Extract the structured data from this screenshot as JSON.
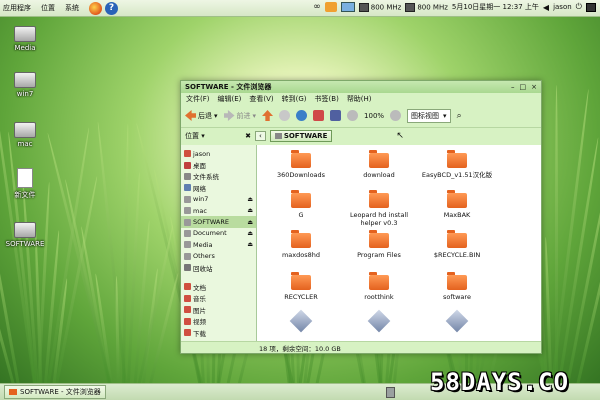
{
  "top_panel": {
    "menus": [
      "应用程序",
      "位置",
      "系统"
    ],
    "cpu1": "800 MHz",
    "cpu2": "800 MHz",
    "datetime": "5月10日星期一 12:37 上午",
    "user": "jason"
  },
  "desktop_icons": [
    "Media",
    "win7",
    "mac",
    "新文件",
    "SOFTWARE"
  ],
  "window": {
    "title": "SOFTWARE - 文件浏览器",
    "menubar": [
      "文件(F)",
      "编辑(E)",
      "查看(V)",
      "转到(G)",
      "书签(B)",
      "帮助(H)"
    ],
    "toolbar": {
      "back": "后退",
      "forward": "前进",
      "zoom": "100%",
      "view": "图标视图"
    },
    "sidebar_title": "位置",
    "path": "SOFTWARE",
    "sidebar_items": [
      {
        "label": "jason",
        "color": "#d05040"
      },
      {
        "label": "桌面",
        "color": "#c04040"
      },
      {
        "label": "文件系统",
        "color": "#888888"
      },
      {
        "label": "网络",
        "color": "#6080b0"
      },
      {
        "label": "win7",
        "color": "#999999",
        "eject": true
      },
      {
        "label": "mac",
        "color": "#999999",
        "eject": true
      },
      {
        "label": "SOFTWARE",
        "color": "#999999",
        "eject": true,
        "selected": true
      },
      {
        "label": "Document",
        "color": "#999999",
        "eject": true
      },
      {
        "label": "Media",
        "color": "#999999",
        "eject": true
      },
      {
        "label": "Others",
        "color": "#999999"
      },
      {
        "label": "回收站",
        "color": "#777777"
      },
      {
        "label": "文档",
        "color": "#d05040"
      },
      {
        "label": "音乐",
        "color": "#d05040"
      },
      {
        "label": "图片",
        "color": "#d05040"
      },
      {
        "label": "视频",
        "color": "#d05040"
      },
      {
        "label": "下载",
        "color": "#d05040"
      }
    ],
    "files": [
      {
        "name": "360Downloads",
        "type": "folder"
      },
      {
        "name": "download",
        "type": "folder"
      },
      {
        "name": "EasyBCD_v1.51汉化版",
        "type": "folder"
      },
      {
        "name": "G",
        "type": "folder"
      },
      {
        "name": "Leopard hd install helper v0.3",
        "type": "folder"
      },
      {
        "name": "MaxBAK",
        "type": "folder"
      },
      {
        "name": "maxdos8hd",
        "type": "folder"
      },
      {
        "name": "Program Files",
        "type": "folder"
      },
      {
        "name": "$RECYCLE.BIN",
        "type": "folder"
      },
      {
        "name": "RECYCLER",
        "type": "folder"
      },
      {
        "name": "rootthink",
        "type": "folder"
      },
      {
        "name": "software",
        "type": "folder"
      },
      {
        "name": "",
        "type": "package"
      },
      {
        "name": "",
        "type": "package"
      },
      {
        "name": "",
        "type": "package"
      }
    ],
    "status": "18 项，剩余空间：10.0 GB"
  },
  "taskbar": {
    "task": "SOFTWARE - 文件浏览器"
  },
  "watermark": "58DAYS.CO"
}
